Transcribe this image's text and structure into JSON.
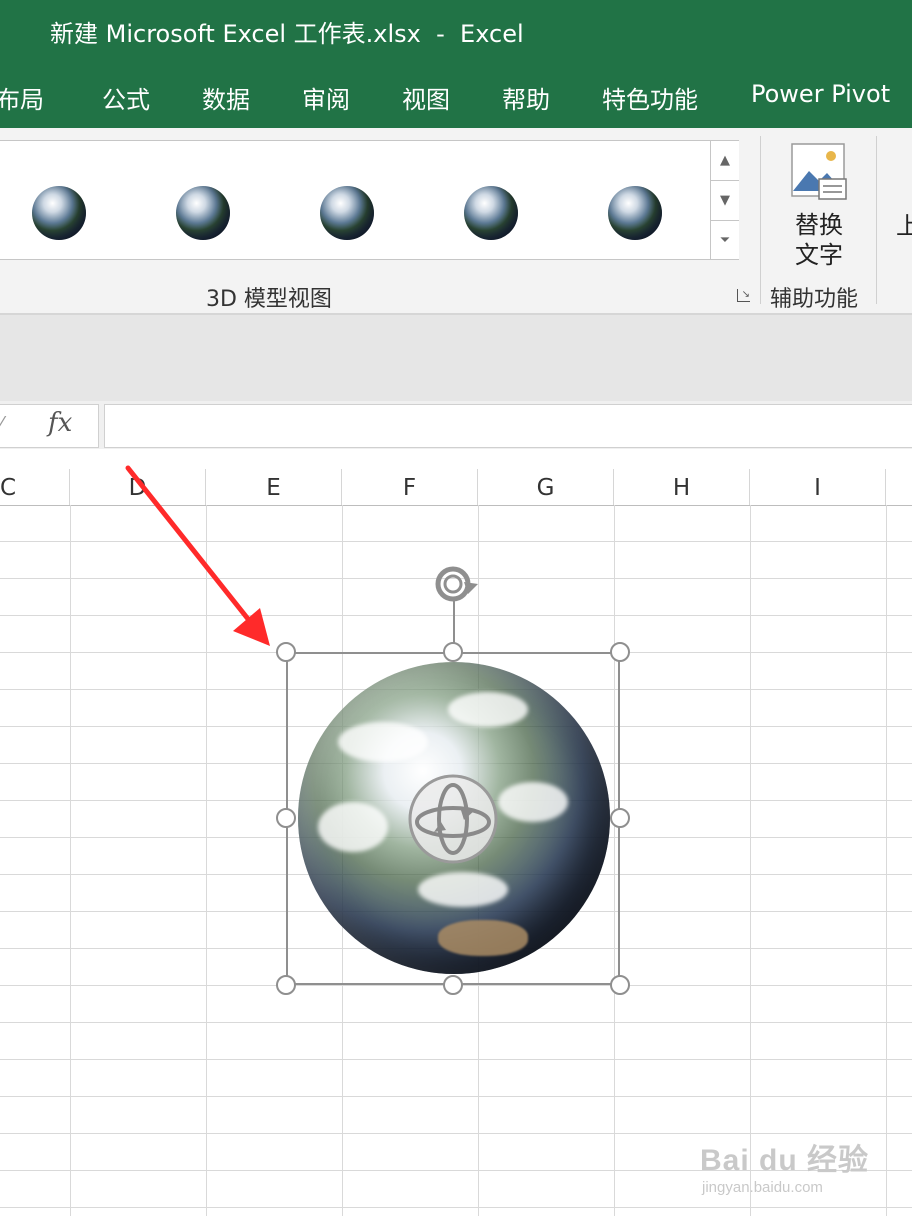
{
  "window": {
    "title": "新建 Microsoft Excel 工作表.xlsx  -  Excel"
  },
  "ribbon_tabs": [
    "布局",
    "公式",
    "数据",
    "审阅",
    "视图",
    "帮助",
    "特色功能",
    "Power Pivot"
  ],
  "ribbon": {
    "group_3d_label": "3D 模型视图",
    "alt_text_label_line1": "替换",
    "alt_text_label_line2": "文字",
    "accessibility_group_label": "辅助功能",
    "cut_off_text": "上"
  },
  "formula_bar": {
    "fx_label": "fx",
    "value": ""
  },
  "columns": [
    "C",
    "D",
    "E",
    "F",
    "G",
    "H",
    "I"
  ],
  "watermark": {
    "main": "Bai du 经验",
    "sub": "jingyan.baidu.com"
  },
  "colors": {
    "excel_green": "#217346",
    "annotation_arrow": "#ff2a2a"
  }
}
